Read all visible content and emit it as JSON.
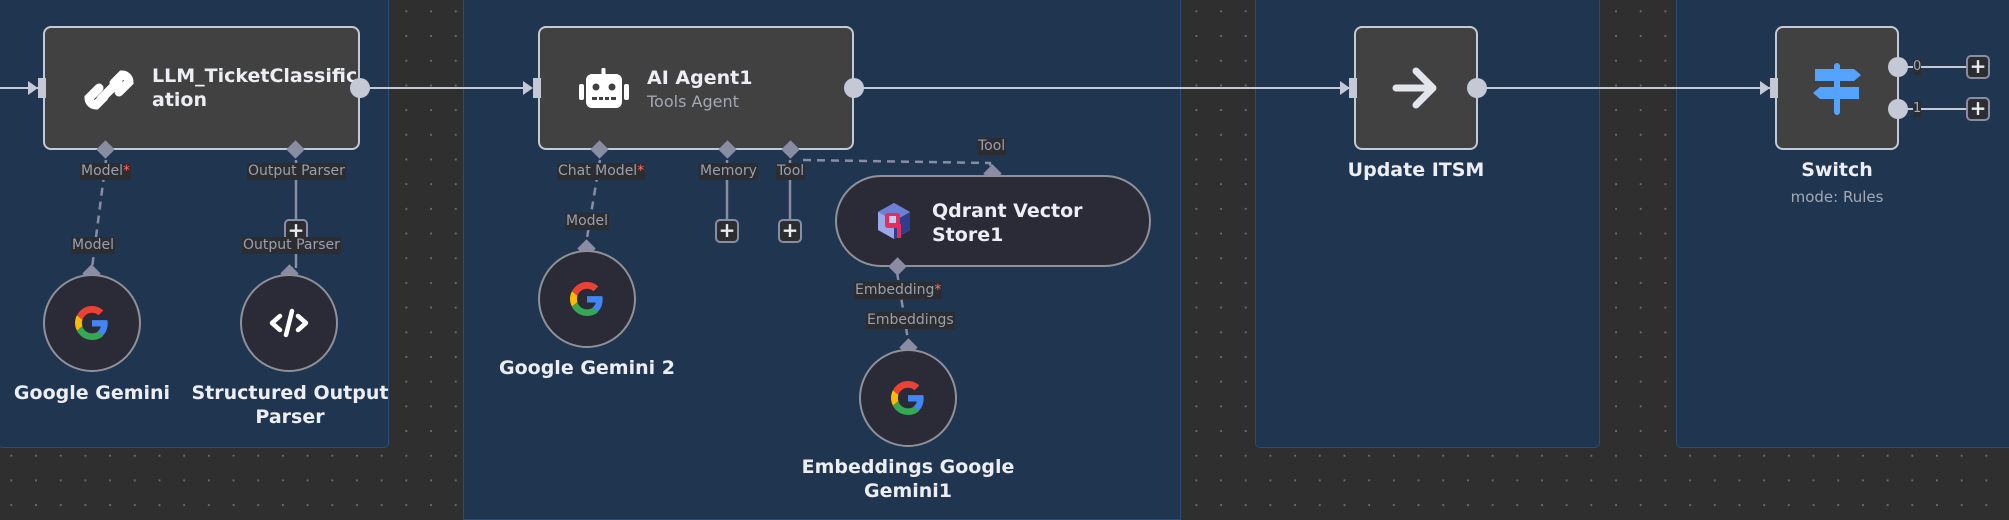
{
  "canvas": {
    "background_color": "#2e2f2e",
    "panel_color": "#1f3550"
  },
  "nodes": {
    "llm_chain": {
      "title": "LLM_TicketClassification",
      "title_line1": "LLM_TicketClassific",
      "title_line2": "ation",
      "icon": "link-icon",
      "ports": {
        "model": "Model",
        "model_required": "*",
        "output_parser": "Output Parser"
      }
    },
    "google_gemini": {
      "title": "Google Gemini",
      "icon": "google-icon",
      "port": "Model"
    },
    "structured_output_parser": {
      "title_line1": "Structured Output",
      "title_line2": "Parser",
      "icon": "code-icon",
      "port": "Output Parser"
    },
    "ai_agent": {
      "title": "AI Agent1",
      "subtitle": "Tools Agent",
      "icon": "robot-icon",
      "ports": {
        "chat_model": "Chat Model",
        "chat_model_required": "*",
        "memory": "Memory",
        "tool": "Tool"
      }
    },
    "google_gemini_2": {
      "title": "Google Gemini 2",
      "icon": "google-icon",
      "port": "Model"
    },
    "qdrant": {
      "title_line1": "Qdrant Vector",
      "title_line2": "Store1",
      "icon": "qdrant-icon",
      "port_top": "Tool",
      "port_bottom": "Embedding",
      "port_bottom_required": "*"
    },
    "embeddings_gemini": {
      "title_line1": "Embeddings Google",
      "title_line2": "Gemini1",
      "icon": "google-icon",
      "port": "Embeddings"
    },
    "update_itsm": {
      "title": "Update ITSM",
      "icon": "arrow-right-icon"
    },
    "switch": {
      "title": "Switch",
      "subtitle": "mode: Rules",
      "icon": "signpost-icon",
      "icon_color": "#54a3ff",
      "outputs": [
        "0",
        "1"
      ]
    }
  },
  "add_button_symbol": "+"
}
